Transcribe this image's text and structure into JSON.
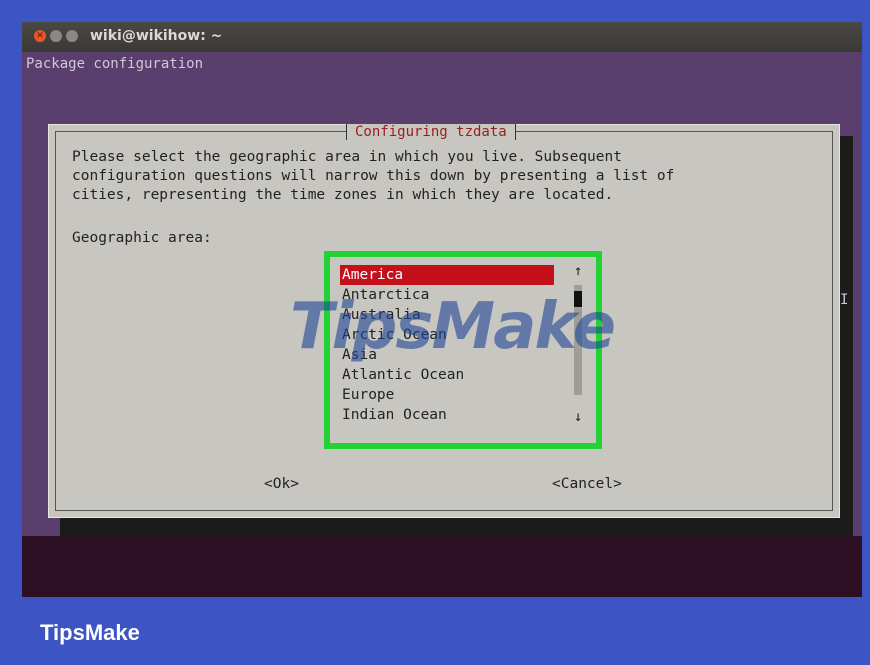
{
  "window": {
    "title": "wiki@wikihow: ~",
    "controls": [
      "close-icon",
      "minimize-icon",
      "maximize-icon"
    ]
  },
  "terminal": {
    "header": "Package configuration"
  },
  "dialog": {
    "title": "Configuring tzdata",
    "description": "Please select the geographic area in which you live. Subsequent\nconfiguration questions will narrow this down by presenting a list of\ncities, representing the time zones in which they are located.",
    "label": "Geographic area:",
    "items": [
      "America",
      "Antarctica",
      "Australia",
      "Arctic Ocean",
      "Asia",
      "Atlantic Ocean",
      "Europe",
      "Indian Ocean"
    ],
    "selected": "America",
    "ok_label": "<Ok>",
    "cancel_label": "<Cancel>"
  },
  "watermark": "TipsMake",
  "brand": "TipsMake",
  "colors": {
    "page_bg": "#3d55c4",
    "terminal_bg": "#5a3f6e",
    "dialog_bg": "#c8c6c0",
    "selection": "#c4101b",
    "highlight_border": "#22d133",
    "title_red": "#9b1d1d"
  }
}
